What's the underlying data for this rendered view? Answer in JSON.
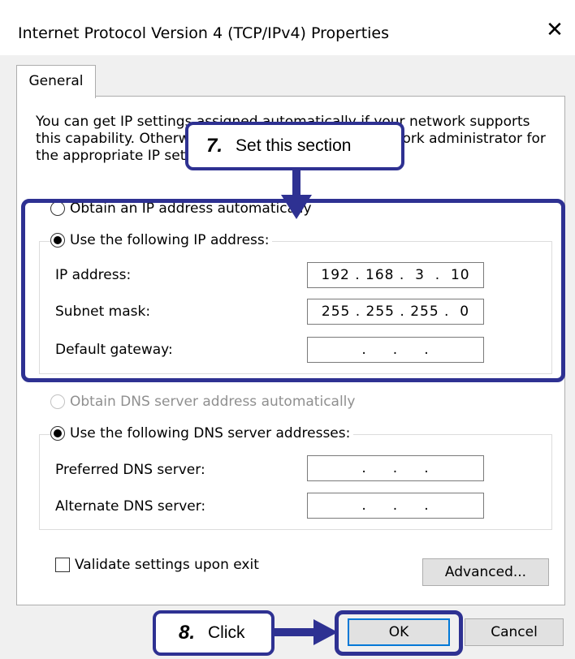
{
  "window": {
    "title": "Internet Protocol Version 4 (TCP/IPv4) Properties",
    "close_glyph": "✕"
  },
  "tabs": [
    {
      "label": "General"
    }
  ],
  "description": "You can get IP settings assigned automatically if your network supports this capability. Otherwise, you need to ask your network administrator for the appropriate IP settings.",
  "ip": {
    "obtain_auto_label": "Obtain an IP address automatically",
    "use_following_label": "Use the following IP address:",
    "fields": [
      {
        "label": "IP address:",
        "value": "192 . 168 .  3  .  10"
      },
      {
        "label": "Subnet mask:",
        "value": "255 . 255 . 255 .  0"
      },
      {
        "label": "Default gateway:",
        "value": " .     .     . "
      }
    ]
  },
  "dns": {
    "obtain_auto_label": "Obtain DNS server address automatically",
    "use_following_label": "Use the following DNS server addresses:",
    "fields": [
      {
        "label": "Preferred DNS server:",
        "value": " .     .     . "
      },
      {
        "label": "Alternate DNS server:",
        "value": " .     .     . "
      }
    ]
  },
  "validate_label": "Validate settings upon exit",
  "buttons": {
    "advanced": "Advanced...",
    "ok": "OK",
    "cancel": "Cancel"
  },
  "annotations": {
    "step7_number": "7.",
    "step7_text": "Set this section",
    "step8_number": "8.",
    "step8_text": "Click",
    "accent_color": "#2e3192"
  }
}
